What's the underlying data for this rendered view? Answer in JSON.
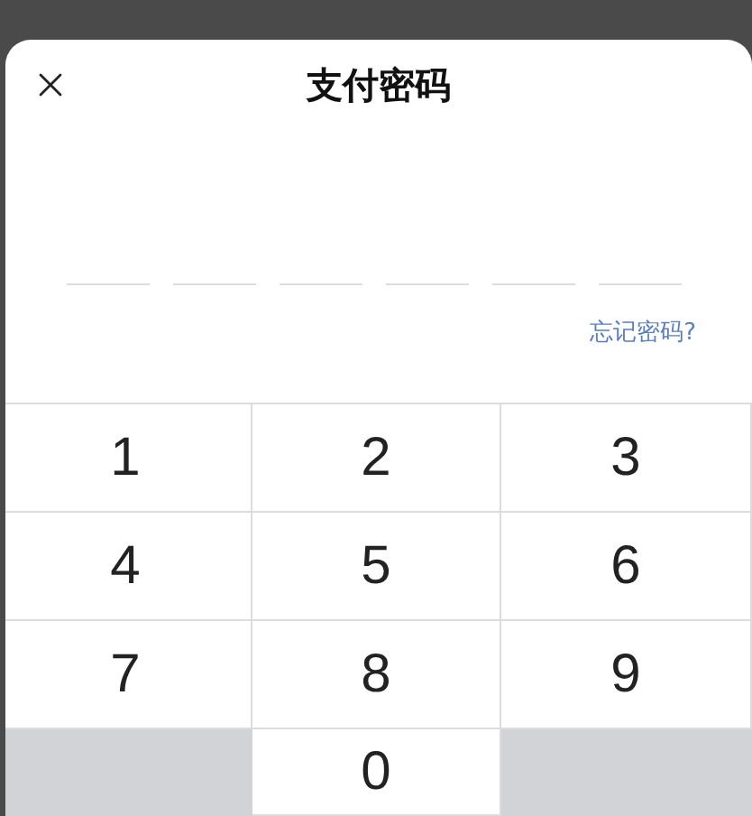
{
  "dialog": {
    "title": "支付密码"
  },
  "password_slots": [
    {
      "filled": false
    },
    {
      "filled": false
    },
    {
      "filled": false
    },
    {
      "filled": false
    },
    {
      "filled": false
    },
    {
      "filled": false
    }
  ],
  "forgot_link": "忘记密码?",
  "keypad": [
    {
      "kind": "digit",
      "label": "1"
    },
    {
      "kind": "digit",
      "label": "2"
    },
    {
      "kind": "digit",
      "label": "3"
    },
    {
      "kind": "digit",
      "label": "4"
    },
    {
      "kind": "digit",
      "label": "5"
    },
    {
      "kind": "digit",
      "label": "6"
    },
    {
      "kind": "digit",
      "label": "7"
    },
    {
      "kind": "digit",
      "label": "8"
    },
    {
      "kind": "digit",
      "label": "9"
    },
    {
      "kind": "blank"
    },
    {
      "kind": "digit",
      "label": "0"
    },
    {
      "kind": "blank"
    }
  ]
}
